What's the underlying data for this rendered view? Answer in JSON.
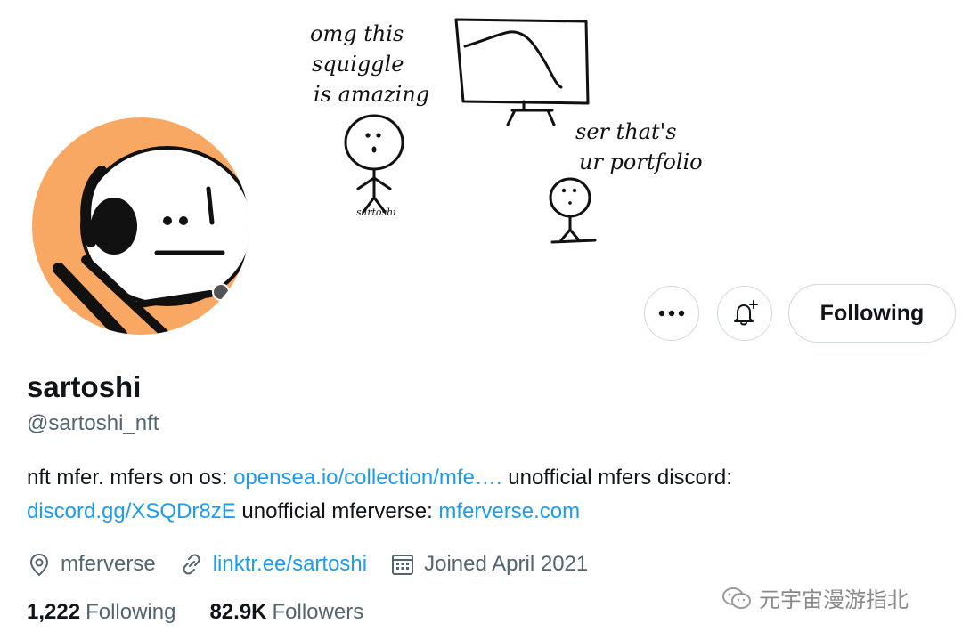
{
  "banner": {
    "caption_left_1": "omg this",
    "caption_left_2": "squiggle",
    "caption_left_3": "is amazing",
    "caption_right_1": "ser that's",
    "caption_right_2": "ur portfolio",
    "figure_label": "sartoshi"
  },
  "actions": {
    "more_icon": "more-horizontal-icon",
    "notify_icon": "bell-plus-icon",
    "follow_label": "Following"
  },
  "profile": {
    "name": "sartoshi",
    "handle": "@sartoshi_nft",
    "bio": {
      "t1": "nft mfer. mfers on os: ",
      "link1": "opensea.io/collection/mfe….",
      "t2": " unofficial mfers discord:",
      "link2": "discord.gg/XSQDr8zE",
      "t3": " unofficial mferverse: ",
      "link3": "mferverse.com"
    },
    "location": "mferverse",
    "website": "linktr.ee/sartoshi",
    "joined": "Joined April 2021"
  },
  "stats": {
    "following_count": "1,222",
    "following_label": "Following",
    "followers_count": "82.9K",
    "followers_label": "Followers"
  },
  "watermark": {
    "text": "元宇宙漫游指北"
  },
  "colors": {
    "accent": "#1d9bf0",
    "avatar_bg": "#f9a864",
    "secondary_text": "#536471",
    "border": "#cfd9de"
  }
}
